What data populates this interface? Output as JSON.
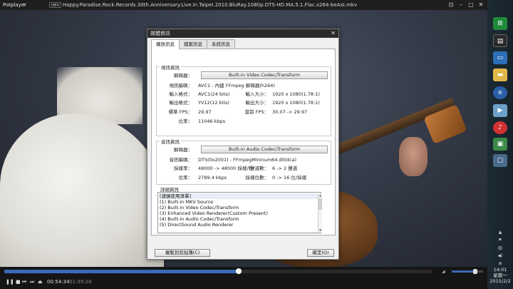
{
  "player": {
    "brand": "Potplayer",
    "codec_badge": "HEV",
    "file_title": "Happy.Paradise.Rock.Records.30th.Anniversary.Live.In.Taipei.2010.BluRay.1080p.DTS-HD.MA.5.1.Flac.x264-beAst.mkv",
    "time_current": "00:54:34",
    "time_total": "01:39:28",
    "seek_fraction": 0.549,
    "volume_fraction": 0.75
  },
  "dialog": {
    "title": "媒體資訊",
    "close": "✕",
    "tabs": [
      {
        "label": "播放訊息"
      },
      {
        "label": "檔案訊息"
      },
      {
        "label": "系統訊息"
      }
    ],
    "video": {
      "group_title": "視訊資訊",
      "decoder_label": "解碼器：",
      "decoder_button": "Built-in Video Codec/Transform",
      "codec_label": "視訊編碼：",
      "codec_value": "AVC1 - 內建 FFmpeg 解碼器(h264)",
      "in_format_label": "輸入格式：",
      "in_format_value": "AVC1(24 bits)",
      "in_size_label": "輸入大小：",
      "in_size_value": "1920 x 1080(1.78:1)",
      "out_format_label": "輸出格式：",
      "out_format_value": "YV12(12 bits)",
      "out_size_label": "輸出大小：",
      "out_size_value": "1920 x 1080(1.78:1)",
      "fps_label": "標準 FPS：",
      "fps_value": "29.97",
      "cur_fps_label": "當前 FPS：",
      "cur_fps_value": "30.07 -> 29.97",
      "bitrate_label": "位率：",
      "bitrate_value": "11046 kbps"
    },
    "audio": {
      "group_title": "音訊資訊",
      "decoder_label": "解碼器：",
      "decoder_button": "Built-in Audio Codec/Transform",
      "codec_label": "音訊編碼：",
      "codec_value": "DTS(0x2001) - FFmpegMininum64.dll(dca)",
      "sample_label": "採樣率：",
      "sample_value": "48000 -> 48000 採樣/秒",
      "channels_label": "聲道數：",
      "channels_value": "6 -> 2 聲道",
      "bitrate_label": "位率：",
      "bitrate_value": "2789.4 kbps",
      "bits_label": "採樣位數：",
      "bits_value": "0 -> 16 位/採樣"
    },
    "details": {
      "group_title": "詳細資訊",
      "items": [
        "[濾鏡使用清單]",
        "(1) Built-in MKV Source",
        "(2) Built-in Video Codec/Transform",
        "(3) Enhanced Video Renderer(Custom Present)",
        "(4) Built-in Audio Codec/Transform",
        "(5) DirectSound Audio Renderer"
      ]
    },
    "copy_button": "複製到剪貼簿(C)",
    "ok_button": "確定(O)"
  },
  "taskbar": {
    "clock_time": "14:01",
    "clock_day": "星期一",
    "clock_date": "2015/2/2",
    "accent": "#2c8cf0"
  }
}
